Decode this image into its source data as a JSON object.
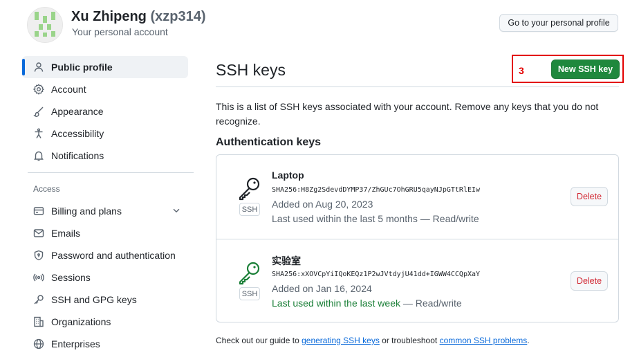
{
  "header": {
    "name": "Xu Zhipeng",
    "handle": "(xzp314)",
    "subtitle": "Your personal account",
    "profile_button": "Go to your personal profile"
  },
  "sidebar": {
    "items": [
      {
        "label": "Public profile",
        "icon": "person-icon",
        "active": true
      },
      {
        "label": "Account",
        "icon": "gear-icon"
      },
      {
        "label": "Appearance",
        "icon": "paintbrush-icon"
      },
      {
        "label": "Accessibility",
        "icon": "accessibility-icon"
      },
      {
        "label": "Notifications",
        "icon": "bell-icon"
      }
    ],
    "access_heading": "Access",
    "access_items": [
      {
        "label": "Billing and plans",
        "icon": "credit-card-icon"
      },
      {
        "label": "Emails",
        "icon": "mail-icon"
      },
      {
        "label": "Password and authentication",
        "icon": "shield-lock-icon"
      },
      {
        "label": "Sessions",
        "icon": "broadcast-icon"
      },
      {
        "label": "SSH and GPG keys",
        "icon": "key-icon"
      },
      {
        "label": "Organizations",
        "icon": "organization-icon"
      },
      {
        "label": "Enterprises",
        "icon": "globe-icon"
      }
    ]
  },
  "main": {
    "title": "SSH keys",
    "annotation_number": "3",
    "new_key_button": "New SSH key",
    "intro": "This is a list of SSH keys associated with your account. Remove any keys that you do not recognize.",
    "section_title": "Authentication keys",
    "keys": [
      {
        "name": "Laptop",
        "fingerprint": "SHA256:H8Zg2SdevdDYMP37/ZhGUc7OhGRU5qayNJpGTtRlEIw",
        "added": "Added on Aug 20, 2023",
        "last_used": "Last used within the last 5 months",
        "access": "— Read/write",
        "badge": "SSH",
        "delete_label": "Delete"
      },
      {
        "name": "实验室",
        "fingerprint": "SHA256:xXOVCpYiIQoKEQz1P2wJVtdyjU41dd+IGWW4CCQpXaY",
        "added": "Added on Jan 16, 2024",
        "last_used": "Last used within the last week",
        "access": "— Read/write",
        "badge": "SSH",
        "delete_label": "Delete"
      }
    ],
    "footer": {
      "prefix": "Check out our guide to",
      "link1": "generating SSH keys",
      "middle": "or troubleshoot",
      "link2": "common SSH problems",
      "suffix": "."
    }
  },
  "colors": {
    "accent_green": "#1f883d",
    "recent_key_green": "#1a7f37",
    "danger": "#d1242f",
    "annotation_red": "#e30000",
    "link": "#0969da"
  }
}
